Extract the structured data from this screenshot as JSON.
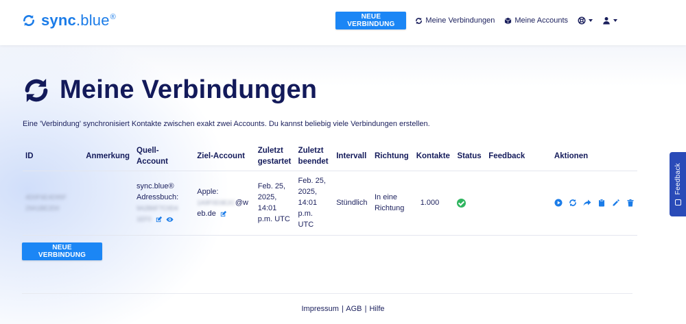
{
  "colors": {
    "brand": "#1b7ce8",
    "primary_button": "#1b86f5",
    "text": "#131a5a",
    "status_ok": "#2fb55f",
    "feedback_tab": "#2a4bb8"
  },
  "header": {
    "logo": {
      "brand": "sync",
      "dot": ".",
      "suffix": "blue",
      "registered": "®",
      "icon": "sync-icon"
    },
    "new_connection_button": "NEUE VERBINDUNG",
    "nav": {
      "connections": {
        "label": "Meine Verbindungen",
        "icon": "sync-icon"
      },
      "accounts": {
        "label": "Meine Accounts",
        "icon": "cube-icon"
      },
      "help_menu": {
        "icon": "lifebuoy-icon"
      },
      "user_menu": {
        "icon": "user-icon"
      }
    }
  },
  "main": {
    "title": "Meine Verbindungen",
    "title_icon": "sync-icon",
    "description": "Eine 'Verbindung' synchronisiert Kontakte zwischen exakt zwei Accounts. Du kannst beliebig viele Verbindungen erstellen.",
    "table": {
      "headers": {
        "id": "ID",
        "note": "Anmerkung",
        "source_line1": "Quell-",
        "source_line2": "Account",
        "target": "Ziel-Account",
        "started_line1": "Zuletzt",
        "started_line2": "gestartet",
        "ended_line1": "Zuletzt",
        "ended_line2": "beendet",
        "interval": "Intervall",
        "direction": "Richtung",
        "contacts": "Kontakte",
        "status": "Status",
        "feedback": "Feedback",
        "actions": "Aktionen"
      },
      "rows": [
        {
          "id_line1": "4D0F6E4D95F",
          "id_line2": "29A1BE2D0",
          "note": "",
          "source_line1": "sync.blue®",
          "source_line2": "Adressbuch:",
          "source_blur1": "9A2B6F7C0D4",
          "source_blur2": "1EF0",
          "target_line1": "Apple:",
          "target_blur": "1A9F0D3E2C",
          "target_visible": "@w",
          "target_line3": "eb.de",
          "started_line1": "Feb. 25,",
          "started_line2": "2025,",
          "started_line3": "14:01",
          "started_line4": "p.m. UTC",
          "ended_line1": "Feb. 25,",
          "ended_line2": "2025,",
          "ended_line3": "14:01",
          "ended_line4": "p.m.",
          "ended_line5": "UTC",
          "interval": "Stündlich",
          "direction_line1": "In eine",
          "direction_line2": "Richtung",
          "contacts": "1.000",
          "status": "ok",
          "feedback": "",
          "actions": [
            "play-icon",
            "sync-icon",
            "share-icon",
            "clipboard-icon",
            "pencil-icon",
            "trash-icon"
          ]
        }
      ]
    },
    "new_connection_button": "NEUE VERBINDUNG"
  },
  "footer": {
    "impressum": "Impressum",
    "sep1": "|",
    "agb": "AGB",
    "sep2": "|",
    "help": "Hilfe"
  },
  "feedback_tab": {
    "label": "Feedback"
  }
}
